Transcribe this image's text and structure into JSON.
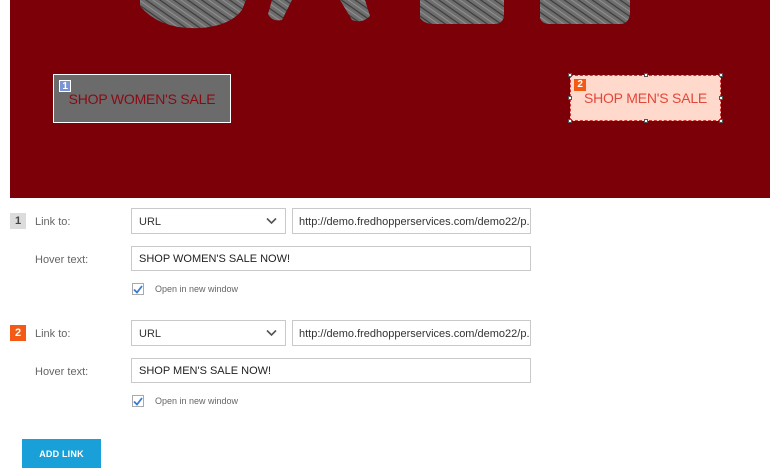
{
  "banner": {
    "background_color": "#7c0008",
    "hotspots": [
      {
        "number": "1",
        "label": "SHOP WOMEN'S SALE"
      },
      {
        "number": "2",
        "label": "SHOP MEN'S SALE"
      }
    ]
  },
  "links": [
    {
      "number": "1",
      "link_to_label": "Link to:",
      "link_type": "URL",
      "url": "http://demo.fredhopperservices.com/demo22/p...",
      "hover_text_label": "Hover text:",
      "hover_text": "SHOP WOMEN'S SALE NOW!",
      "open_new_window_label": "Open in new window",
      "open_new_window_checked": true
    },
    {
      "number": "2",
      "link_to_label": "Link to:",
      "link_type": "URL",
      "url": "http://demo.fredhopperservices.com/demo22/p...",
      "hover_text_label": "Hover text:",
      "hover_text": "SHOP MEN'S SALE NOW!",
      "open_new_window_label": "Open in new window",
      "open_new_window_checked": true
    }
  ],
  "add_link_label": "ADD LINK",
  "colors": {
    "accent_orange": "#f25a16",
    "button_blue": "#1aa0d8",
    "checkbox_blue": "#3a7bd5"
  },
  "icons": {
    "select_arrow": "chevron-down-icon",
    "checkmark": "checkmark-icon"
  }
}
